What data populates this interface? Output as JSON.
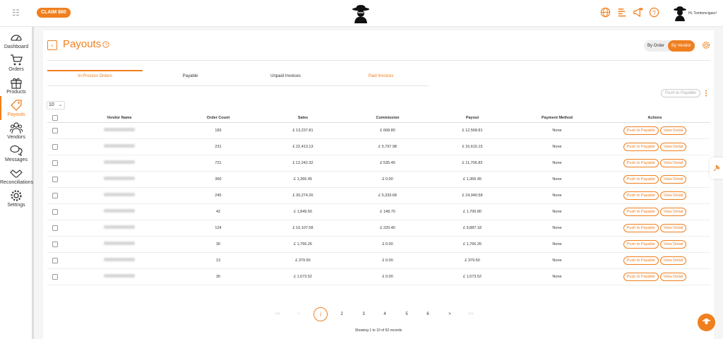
{
  "topbar": {
    "claim_label": "CLAIM $60",
    "greeting": "Hi, Tomtomcigars!",
    "icons": [
      "globe-icon",
      "list-icon",
      "megaphone-icon",
      "help-icon"
    ]
  },
  "sidebar": {
    "items": [
      {
        "label": "Dashboard",
        "icon": "dashboard-icon"
      },
      {
        "label": "Orders",
        "icon": "cart-icon"
      },
      {
        "label": "Products",
        "icon": "gift-icon"
      },
      {
        "label": "Payouts",
        "icon": "tag-icon",
        "active": true
      },
      {
        "label": "Vendors",
        "icon": "users-icon"
      },
      {
        "label": "Messages",
        "icon": "chat-icon"
      },
      {
        "label": "Reconciliations",
        "icon": "handshake-icon"
      },
      {
        "label": "Settings",
        "icon": "gear-icon"
      }
    ]
  },
  "page": {
    "title": "Payouts",
    "toggle": {
      "by_order": "By Order",
      "by_vendor": "By Vendor",
      "selected": "By Vendor"
    },
    "tabs": [
      "In-Process Orders",
      "Payable",
      "Unpaid Invoices",
      "Paid Invoices"
    ],
    "active_tab": "In-Process Orders",
    "push_to_payable": "Push to Payable",
    "page_size": "10"
  },
  "table": {
    "headers": [
      "Vendor Name",
      "Order Count",
      "Sales",
      "Commission",
      "Payout",
      "Payment Method",
      "Actions"
    ],
    "rows": [
      {
        "count": "183",
        "sales": "£ 13,237.81",
        "commission": "£ 668.80",
        "payout": "£ 12,568.81",
        "method": "None"
      },
      {
        "count": "231",
        "sales": "£ 22,413.13",
        "commission": "£ 5,797.98",
        "payout": "£ 16,615.15",
        "method": "None"
      },
      {
        "count": "721",
        "sales": "£ 12,242.32",
        "commission": "£ 535.49",
        "payout": "£ 11,706.83",
        "method": "None"
      },
      {
        "count": "360",
        "sales": "£ 1,366.45",
        "commission": "£ 0.00",
        "payout": "£ 1,366.45",
        "method": "None"
      },
      {
        "count": "245",
        "sales": "£ 30,274.26",
        "commission": "£ 5,333.68",
        "payout": "£ 24,940.58",
        "method": "None"
      },
      {
        "count": "42",
        "sales": "£ 1,849.50",
        "commission": "£ 148.70",
        "payout": "£ 1,700.80",
        "method": "None"
      },
      {
        "count": "124",
        "sales": "£ 10,107.58",
        "commission": "£ 220.40",
        "payout": "£ 9,887.18",
        "method": "None"
      },
      {
        "count": "30",
        "sales": "£ 1,766.26",
        "commission": "£ 0.00",
        "payout": "£ 1,766.26",
        "method": "None"
      },
      {
        "count": "13",
        "sales": "£ 379.50",
        "commission": "£ 0.00",
        "payout": "£ 379.50",
        "method": "None"
      },
      {
        "count": "30",
        "sales": "£ 1,573.52",
        "commission": "£ 0.00",
        "payout": "£ 1,573.52",
        "method": "None"
      }
    ],
    "action_push": "Push to Payable",
    "action_view": "View Detail"
  },
  "pagination": {
    "first": "<<",
    "prev": "<",
    "pages": [
      "1",
      "2",
      "3",
      "4",
      "5",
      "6"
    ],
    "current": "1",
    "next": ">",
    "last": ">>",
    "summary": "Showing 1 to 10 of 52 records"
  },
  "colors": {
    "accent": "#f07f1f"
  }
}
